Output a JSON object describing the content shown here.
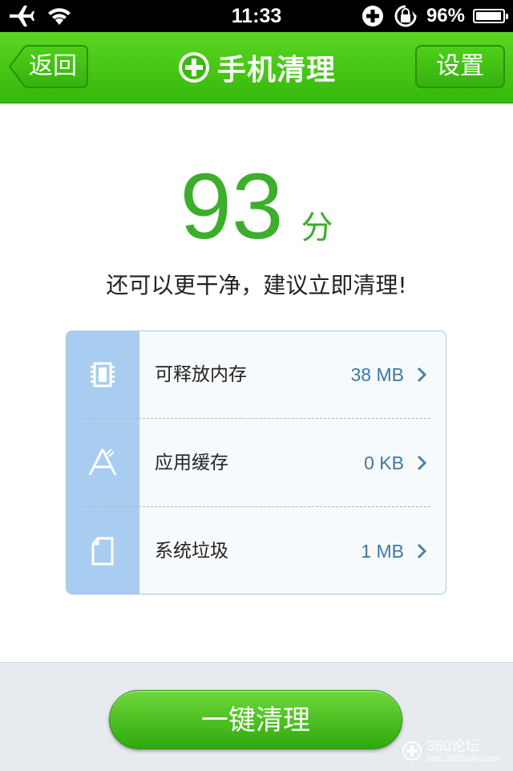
{
  "status_bar": {
    "time": "11:33",
    "battery": "96%",
    "battery_level": 0.96
  },
  "nav": {
    "back_label": "返回",
    "title": "手机清理",
    "settings_label": "设置"
  },
  "score": {
    "value": "93",
    "unit": "分",
    "advice": "还可以更干净，建议立即清理!"
  },
  "items": [
    {
      "label": "可释放内存",
      "value": "38 MB",
      "icon": "memory-chip-icon"
    },
    {
      "label": "应用缓存",
      "value": "0 KB",
      "icon": "app-store-icon"
    },
    {
      "label": "系统垃圾",
      "value": "1 MB",
      "icon": "document-icon"
    }
  ],
  "action": {
    "clean_label": "一键清理"
  },
  "watermark": {
    "brand": "360论坛",
    "url": "bbs.360safe.com"
  },
  "colors": {
    "accent_green": "#3dae2c",
    "navbar_green": "#4ac81a",
    "value_blue": "#3c78a6",
    "sidebar_blue": "#a9cdf1"
  }
}
